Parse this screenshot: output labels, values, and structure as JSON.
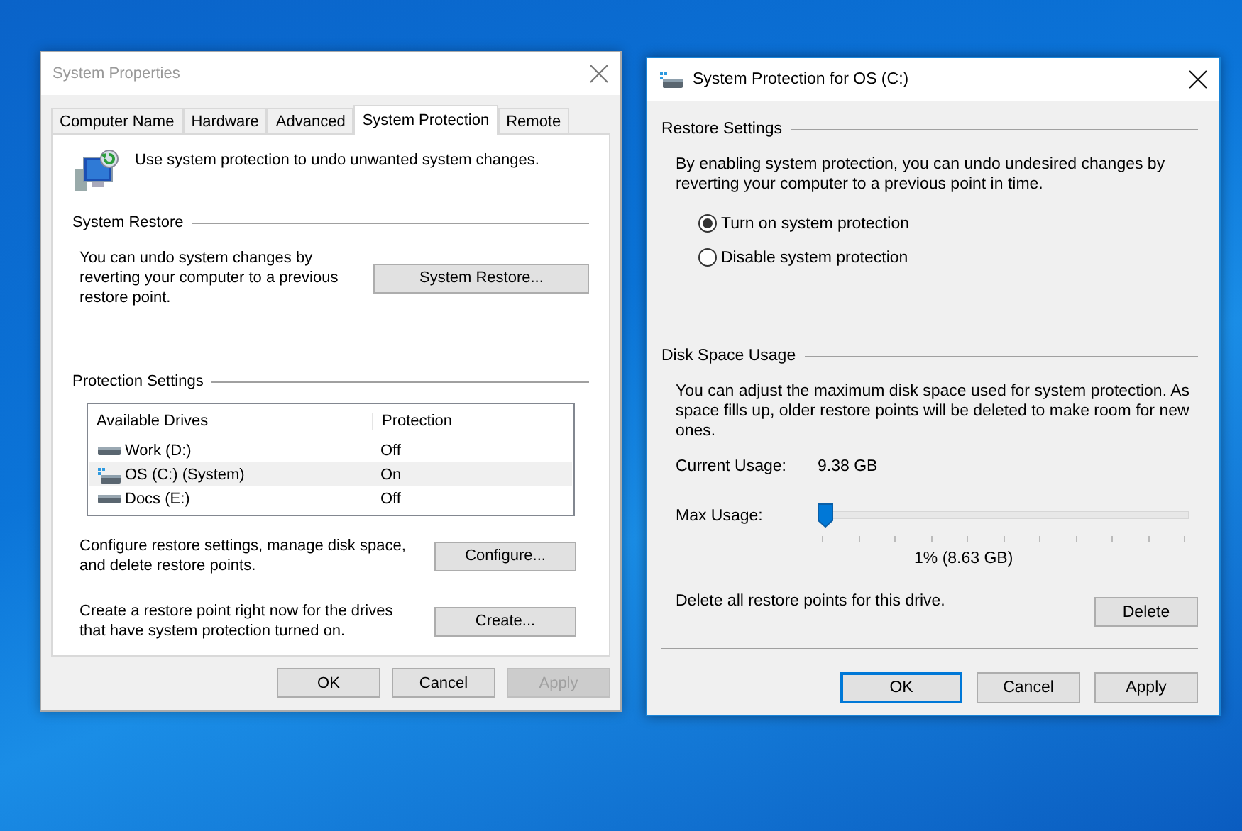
{
  "system_properties": {
    "title": "System Properties",
    "active": false,
    "tabs": [
      {
        "label": "Computer Name",
        "selected": false
      },
      {
        "label": "Hardware",
        "selected": false
      },
      {
        "label": "Advanced",
        "selected": false
      },
      {
        "label": "System Protection",
        "selected": true
      },
      {
        "label": "Remote",
        "selected": false
      }
    ],
    "intro": "Use system protection to undo unwanted system changes.",
    "system_restore": {
      "heading": "System Restore",
      "text": "You can undo system changes by reverting your computer to a previous restore point.",
      "button": "System Restore..."
    },
    "protection_settings": {
      "heading": "Protection Settings",
      "columns": [
        "Available Drives",
        "Protection"
      ],
      "rows": [
        {
          "kind": "data",
          "drive": "Work (D:)",
          "protection": "Off",
          "selected": false
        },
        {
          "kind": "system",
          "drive": "OS (C:) (System)",
          "protection": "On",
          "selected": true
        },
        {
          "kind": "data",
          "drive": "Docs (E:)",
          "protection": "Off",
          "selected": false
        }
      ]
    },
    "configure": {
      "text": "Configure restore settings, manage disk space, and delete restore points.",
      "button": "Configure..."
    },
    "create": {
      "text": "Create a restore point right now for the drives that have system protection turned on.",
      "button": "Create..."
    },
    "buttons": [
      {
        "label": "OK",
        "disabled": false
      },
      {
        "label": "Cancel",
        "disabled": false
      },
      {
        "label": "Apply",
        "disabled": true
      }
    ]
  },
  "protection_dialog": {
    "title": "System Protection for OS (C:)",
    "active": true,
    "restore_settings": {
      "heading": "Restore Settings",
      "text": "By enabling system protection, you can undo undesired changes by reverting your computer to a previous point in time.",
      "options": [
        {
          "label": "Turn on system protection",
          "selected": true
        },
        {
          "label": "Disable system protection",
          "selected": false
        }
      ]
    },
    "disk_space_usage": {
      "heading": "Disk Space Usage",
      "text": "You can adjust the maximum disk space used for system protection. As space fills up, older restore points will be deleted to make room for new ones.",
      "current_usage_label": "Current Usage:",
      "current_usage": "9.38 GB",
      "max_usage_label": "Max Usage:",
      "max_usage": {
        "level": 0.0
      },
      "max_usage_reading": "1% (8.63 GB)",
      "delete_text": "Delete all restore points for this drive.",
      "delete_button": "Delete"
    },
    "buttons": [
      {
        "label": "OK",
        "default": true
      },
      {
        "label": "Cancel",
        "default": false
      },
      {
        "label": "Apply",
        "default": false
      }
    ]
  }
}
